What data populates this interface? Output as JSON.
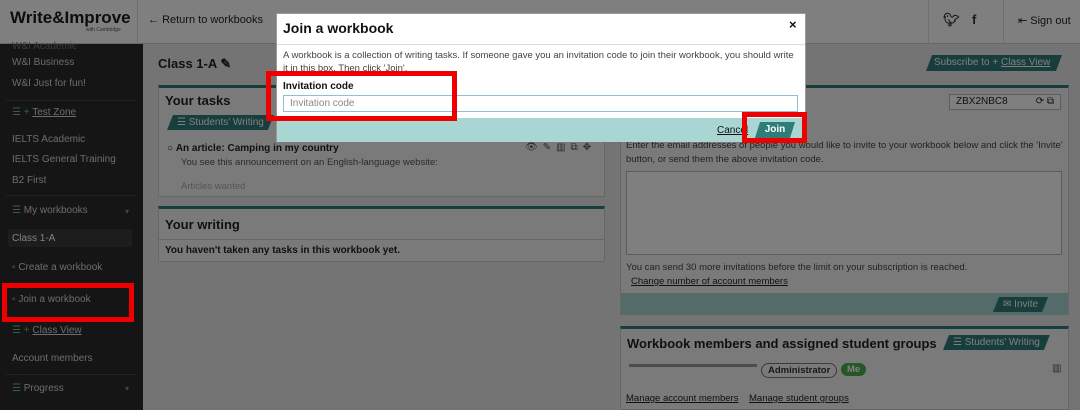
{
  "header": {
    "logo": "Write&Improve",
    "logo_sub": "with Cambridge",
    "return_label": "Return to workbooks",
    "twitter_icon": "twitter-icon",
    "facebook_icon": "facebook-icon",
    "signout_label": "Sign out"
  },
  "sidebar": {
    "top_faded": "W&I Academic",
    "items": [
      {
        "label": "W&I Business"
      },
      {
        "label": "W&I Just for fun!"
      },
      {
        "label": "Test Zone"
      },
      {
        "label": "IELTS Academic"
      },
      {
        "label": "IELTS General Training"
      },
      {
        "label": "B2 First"
      },
      {
        "label": "My workbooks"
      },
      {
        "label": "Class 1-A"
      },
      {
        "label": "Create a workbook"
      },
      {
        "label": "Join a workbook"
      },
      {
        "label": "Class View"
      },
      {
        "label": "Account members"
      },
      {
        "label": "Progress"
      }
    ]
  },
  "main": {
    "class_title": "Class 1-A",
    "subscribe_label": "Subscribe to",
    "subscribe_link": "Class View",
    "tasks_title": "Your tasks",
    "students_writing_tab": "Students' Writing",
    "task_item_title": "An article: Camping in my country",
    "task_item_desc": "You see this announcement on an English-language website:",
    "task_item_faded": "Articles wanted",
    "writing_title": "Your writing",
    "writing_empty": "You haven't taken any tasks in this workbook yet.",
    "invite_code": "ZBX2NBC8",
    "invite_text_1": "Enter the email addresses of people you would like to invite to your workbook below and click the 'Invite'",
    "invite_text_2": "button, or send them the above invitation code.",
    "invite_limit": "You can send 30 more invitations before the limit on your subscription is reached.",
    "change_members": "Change number of account members",
    "invite_button": "Invite",
    "members_title": "Workbook members and assigned student groups",
    "members_tab": "Students' Writing",
    "role_badge": "Administrator",
    "me_badge": "Me",
    "manage_members": "Manage account members",
    "manage_groups": "Manage student groups"
  },
  "modal": {
    "title": "Join a workbook",
    "close": "×",
    "description": "A workbook is a collection of writing tasks. If someone gave you an invitation code to join their workbook, you should write it in this box. Then click 'Join'.",
    "code_label": "Invitation code",
    "code_placeholder": "Invitation code",
    "code_value": "",
    "cancel_label": "Cancel",
    "join_label": "Join"
  },
  "colors": {
    "accent": "#2e7d78",
    "highlight": "#ee0000",
    "sidebar_bg": "#2b2b2b"
  }
}
